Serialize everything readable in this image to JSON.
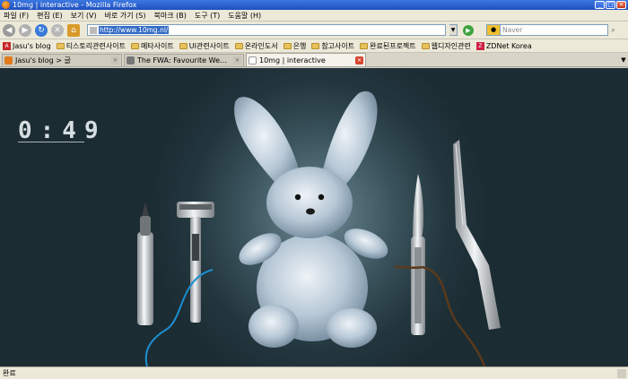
{
  "window": {
    "title": "10mg | interactive - Mozilla Firefox",
    "min": "_",
    "max": "□",
    "close": "×"
  },
  "menu": [
    "파일 (F)",
    "편집 (E)",
    "보기 (V)",
    "바로 가기 (S)",
    "북마크 (B)",
    "도구 (T)",
    "도움말 (H)"
  ],
  "nav": {
    "url": "http://www.10mg.nl/",
    "search_placeholder": "Naver"
  },
  "bookmarks": [
    {
      "label": "Jasu's blog",
      "icon": "favicon"
    },
    {
      "label": "티스토리관련사이트",
      "icon": "folder"
    },
    {
      "label": "메타사이트",
      "icon": "folder"
    },
    {
      "label": "UI관련사이트",
      "icon": "folder"
    },
    {
      "label": "온라인도서",
      "icon": "folder"
    },
    {
      "label": "은행",
      "icon": "folder"
    },
    {
      "label": "참고사이트",
      "icon": "folder"
    },
    {
      "label": "완료된프로젝트",
      "icon": "folder"
    },
    {
      "label": "웹디자인관련",
      "icon": "folder"
    },
    {
      "label": "ZDNet Korea",
      "icon": "favicon"
    }
  ],
  "tabs": [
    {
      "label": "Jasu's blog > 글",
      "active": false
    },
    {
      "label": "The FWA: Favourite Website Aw...",
      "active": false
    },
    {
      "label": "10mg | interactive",
      "active": true
    }
  ],
  "content": {
    "timer": "0:49"
  },
  "status": {
    "text": "완료"
  }
}
